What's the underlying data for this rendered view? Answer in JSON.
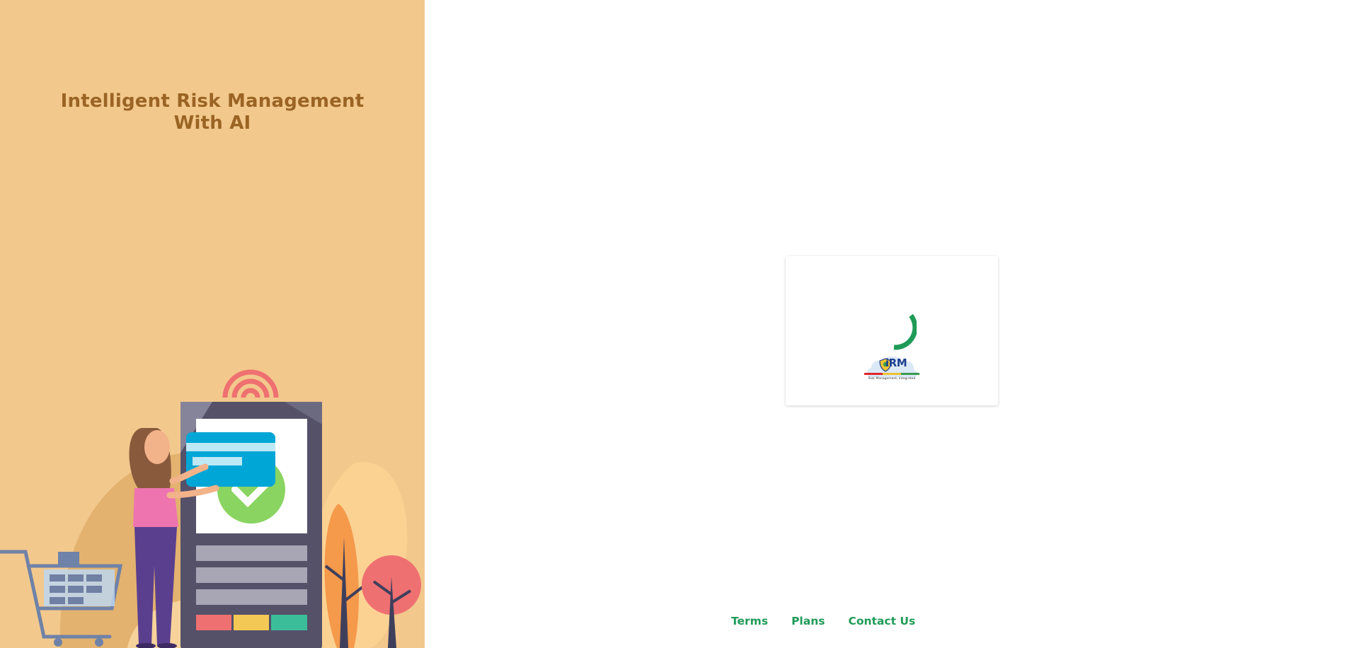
{
  "hero": {
    "title_line1": "Intelligent Risk Management",
    "title_line2": "With AI"
  },
  "loading": {
    "logo_text": "iRM",
    "logo_tagline": "Risk Management, Integrated"
  },
  "footer": {
    "links": [
      "Terms",
      "Plans",
      "Contact Us"
    ]
  },
  "colors": {
    "left_panel_bg": "#f2c88c",
    "hero_title": "#9a6424",
    "accent_green": "#1f9b58",
    "logo_blue": "#1c3f8f"
  }
}
